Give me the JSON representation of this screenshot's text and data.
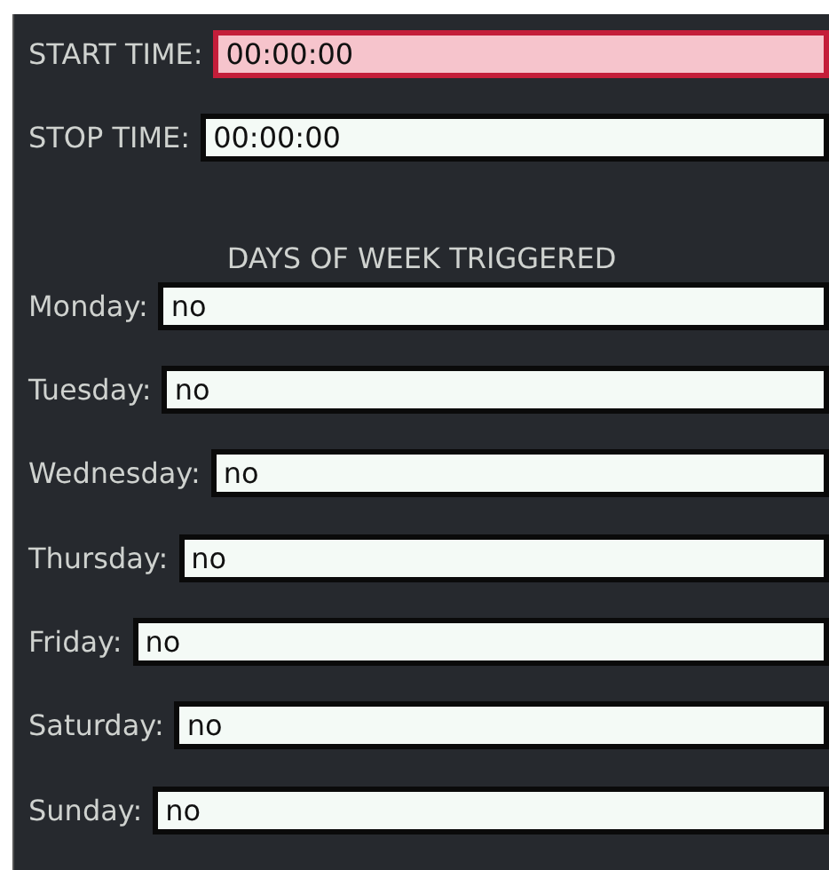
{
  "time_fields": [
    {
      "label": "START TIME:",
      "value": "00:00:00",
      "invalid": true
    },
    {
      "label": "STOP TIME:",
      "value": "00:00:00",
      "invalid": false
    }
  ],
  "days_heading": "DAYS OF WEEK TRIGGERED",
  "days": [
    {
      "label": "Monday:",
      "value": "no"
    },
    {
      "label": "Tuesday:",
      "value": "no"
    },
    {
      "label": "Wednesday:",
      "value": "no"
    },
    {
      "label": "Thursday:",
      "value": "no"
    },
    {
      "label": "Friday:",
      "value": "no"
    },
    {
      "label": "Saturday:",
      "value": "no"
    },
    {
      "label": "Sunday:",
      "value": "no"
    }
  ]
}
